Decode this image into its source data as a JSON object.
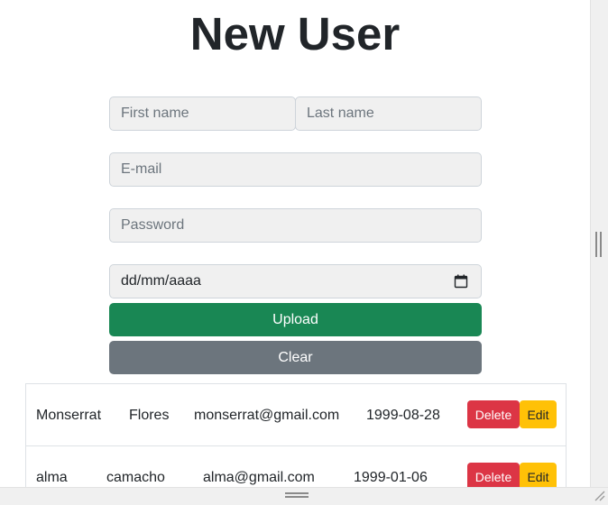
{
  "form": {
    "title": "New User",
    "first_name_placeholder": "First name",
    "last_name_placeholder": "Last name",
    "email_placeholder": "E-mail",
    "password_placeholder": "Password",
    "date_placeholder": "dd/mm/aaaa",
    "upload_label": "Upload",
    "clear_label": "Clear"
  },
  "users": [
    {
      "first_name": "Monserrat",
      "last_name": "Flores",
      "email": "monserrat@gmail.com",
      "birthdate": "1999-08-28",
      "delete_label": "Delete",
      "edit_label": "Edit"
    },
    {
      "first_name": "alma",
      "last_name": "camacho",
      "email": "alma@gmail.com",
      "birthdate": "1999-01-06",
      "delete_label": "Delete",
      "edit_label": "Edit"
    }
  ],
  "icons": {
    "calendar": "calendar-icon"
  },
  "colors": {
    "upload": "#198754",
    "clear": "#6c757d",
    "delete": "#dc3545",
    "edit": "#ffc107",
    "input_bg": "#f0f0f0"
  }
}
